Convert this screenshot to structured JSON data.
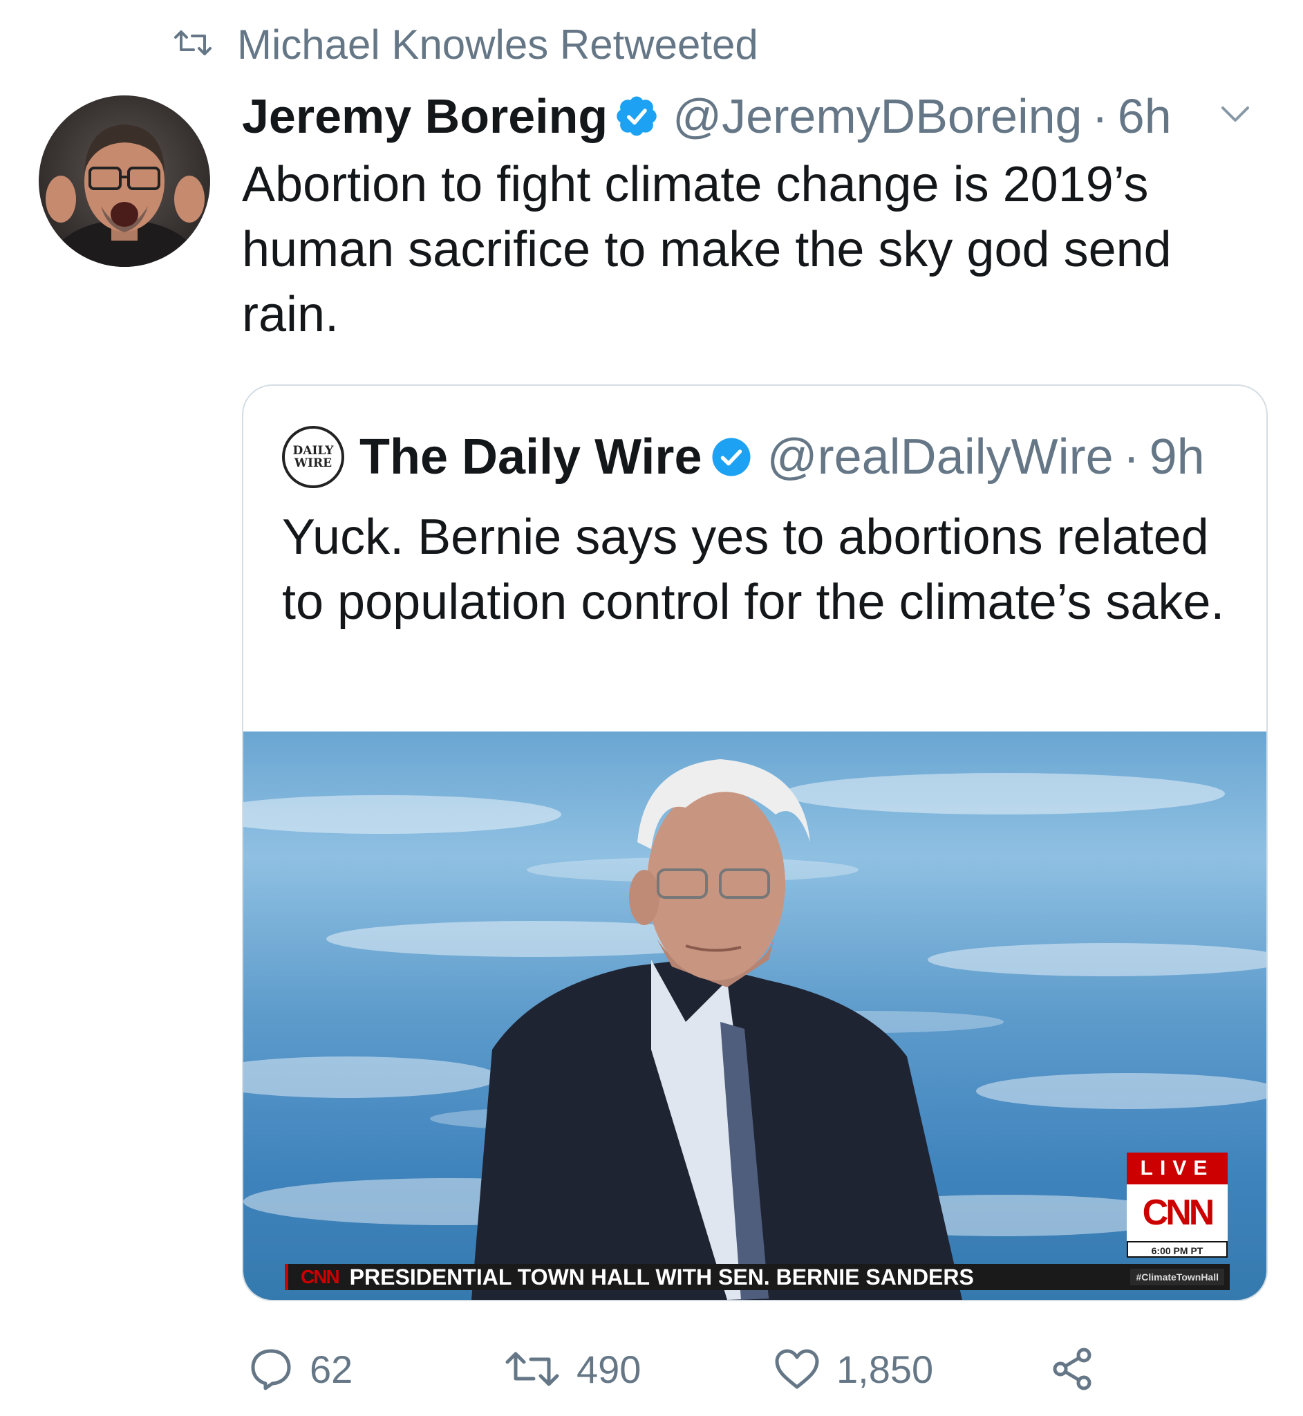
{
  "retweet_context": {
    "icon": "retweet-icon",
    "text": "Michael Knowles Retweeted"
  },
  "tweet": {
    "author_name": "Jeremy Boreing",
    "author_handle": "@JeremyDBoreing",
    "separator": "·",
    "time": "6h",
    "text": "Abortion to fight climate change is 2019’s human sacrifice to make the sky god send rain.",
    "verified_color": "#1da1f2"
  },
  "quoted_tweet": {
    "logo_line1": "DAILY",
    "logo_line2": "WIRE",
    "author_name": "The Daily Wire",
    "author_handle": "@realDailyWire",
    "separator": "·",
    "time": "9h",
    "text": "Yuck. Bernie says yes to abortions related to population control for the climate’s sake.",
    "media": {
      "live_label": "LIVE",
      "network_logo": "CNN",
      "time_badge": "6:00 PM PT",
      "ticker_network": "CNN",
      "ticker_text": "PRESIDENTIAL TOWN HALL WITH SEN. BERNIE SANDERS",
      "ticker_hashtag": "#ClimateTownHall"
    }
  },
  "actions": {
    "reply_count": "62",
    "retweet_count": "490",
    "like_count": "1,850"
  },
  "colors": {
    "secondary_text": "#657786",
    "accent": "#1da1f2",
    "cnn_red": "#cc0000"
  }
}
